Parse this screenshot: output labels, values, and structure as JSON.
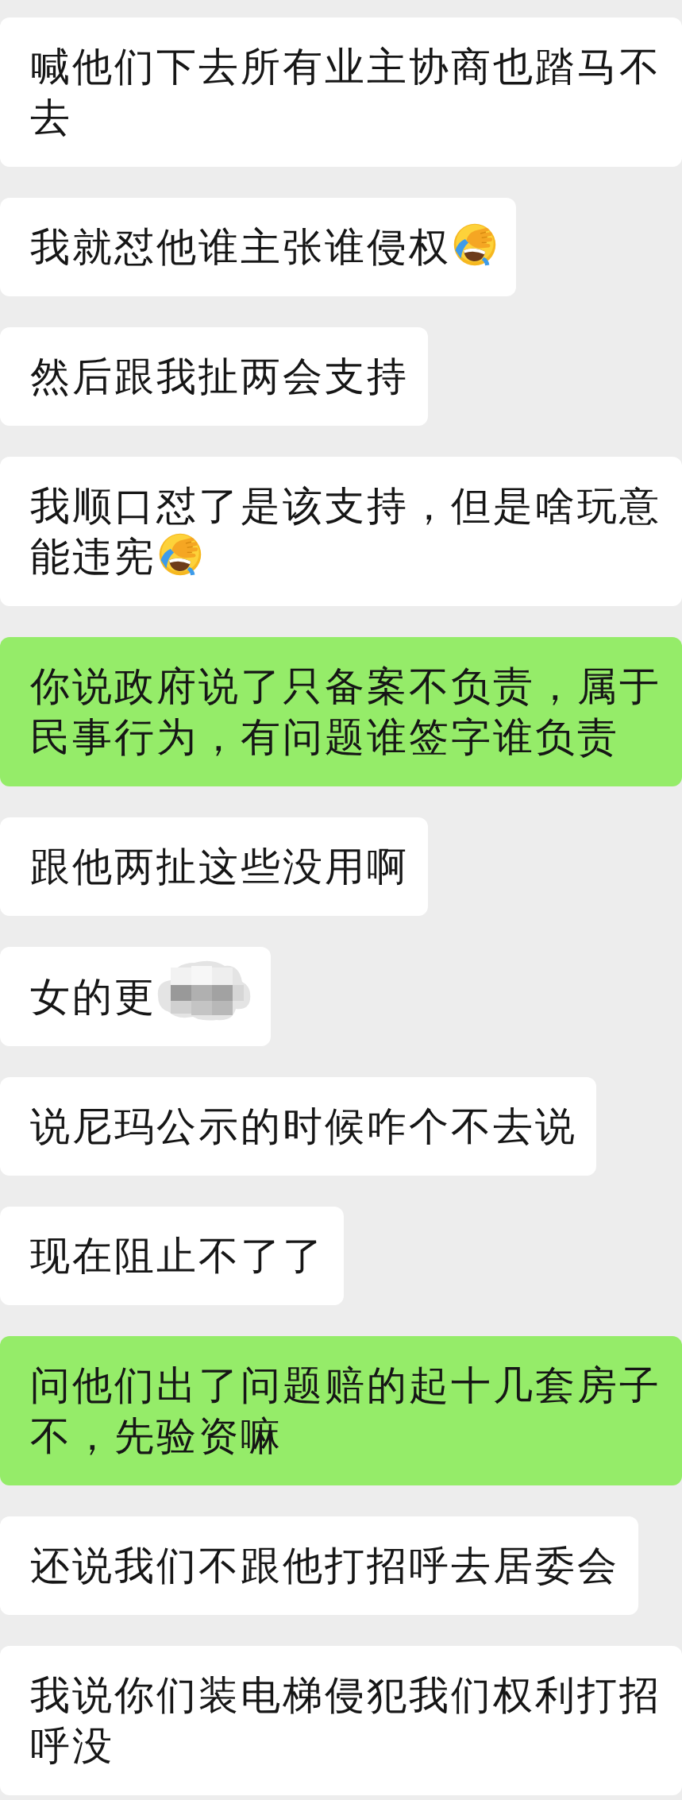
{
  "messages": [
    {
      "text": "喊他们下去所有业主协商也踏马不去",
      "outgoing": false,
      "emoji": false,
      "redacted": false
    },
    {
      "text": "我就怼他谁主张谁侵权",
      "outgoing": false,
      "emoji": true,
      "redacted": false
    },
    {
      "text": "然后跟我扯两会支持",
      "outgoing": false,
      "emoji": false,
      "redacted": false
    },
    {
      "text": "我顺口怼了是该支持，但是啥玩意能违宪",
      "outgoing": false,
      "emoji": true,
      "redacted": false
    },
    {
      "text": "你说政府说了只备案不负责，属于民事行为，有问题谁签字谁负责",
      "outgoing": true,
      "emoji": false,
      "redacted": false
    },
    {
      "text": "跟他两扯这些没用啊",
      "outgoing": false,
      "emoji": false,
      "redacted": false
    },
    {
      "text": "女的更",
      "outgoing": false,
      "emoji": false,
      "redacted": true
    },
    {
      "text": "说尼玛公示的时候咋个不去说",
      "outgoing": false,
      "emoji": false,
      "redacted": false
    },
    {
      "text": "现在阻止不了了",
      "outgoing": false,
      "emoji": false,
      "redacted": false
    },
    {
      "text": "问他们出了问题赔的起十几套房子不，先验资嘛",
      "outgoing": true,
      "emoji": false,
      "redacted": false
    },
    {
      "text": "还说我们不跟他打招呼去居委会",
      "outgoing": false,
      "emoji": false,
      "redacted": false
    },
    {
      "text": "我说你们装电梯侵犯我们权利打招呼没",
      "outgoing": false,
      "emoji": false,
      "redacted": false
    }
  ]
}
